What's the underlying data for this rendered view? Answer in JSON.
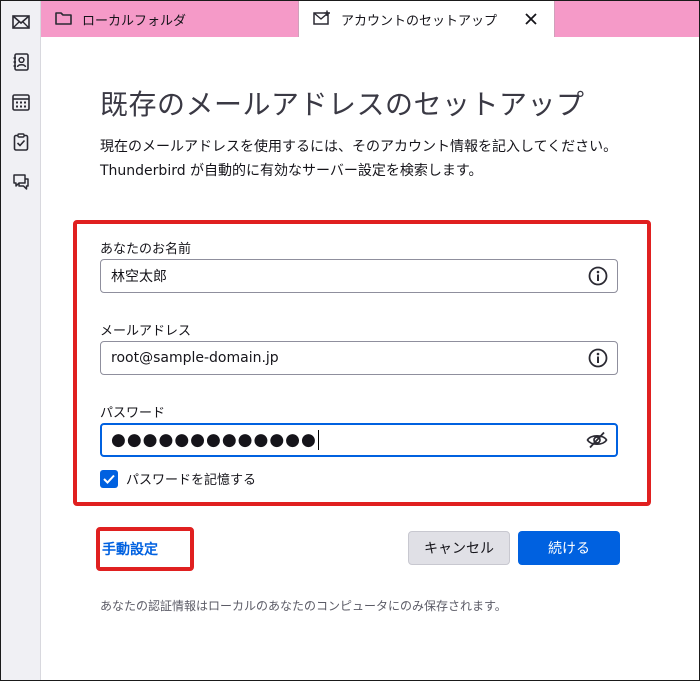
{
  "tabs": [
    {
      "label": "ローカルフォルダ",
      "icon": "folder-icon"
    },
    {
      "label": "アカウントのセットアップ",
      "icon": "mail-new-icon"
    }
  ],
  "spaces": [
    "mail-icon",
    "address-book-icon",
    "calendar-icon",
    "tasks-icon",
    "chat-icon"
  ],
  "page": {
    "title": "既存のメールアドレスのセットアップ",
    "description_line1": "現在のメールアドレスを使用するには、そのアカウント情報を記入してください。",
    "description_line2": "Thunderbird が自動的に有効なサーバー設定を検索します。"
  },
  "form": {
    "name_label": "あなたのお名前",
    "name_value": "林空太郎",
    "email_label": "メールアドレス",
    "email_value": "root@sample-domain.jp",
    "password_label": "パスワード",
    "password_value": "●●●●●●●●●●●●●",
    "remember_label": "パスワードを記憶する",
    "remember_checked": true
  },
  "actions": {
    "manual_label": "手動設定",
    "cancel_label": "キャンセル",
    "continue_label": "続ける"
  },
  "footnote": "あなたの認証情報はローカルのあなたのコンピュータにのみ保存されます。",
  "colors": {
    "tab_strip": "#f59ac8",
    "accent": "#0061e0",
    "highlight": "#e02020"
  }
}
